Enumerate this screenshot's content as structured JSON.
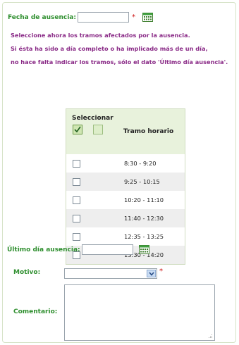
{
  "form": {
    "fecha_label": "Fecha de ausencia:",
    "fecha_value": "",
    "required_mark": "*",
    "info": [
      "Seleccione ahora los tramos afectados por la ausencia.",
      "Si ésta ha sido a día completo o ha implicado más de un día,",
      "no hace falta indicar los tramos, sólo el dato 'Último día ausencia'."
    ],
    "table": {
      "col_select": "Seleccionar",
      "col_tramo": "Tramo horario",
      "rows": [
        {
          "tramo": "8:30 - 9:20",
          "checked": false
        },
        {
          "tramo": "9:25 - 10:15",
          "checked": false
        },
        {
          "tramo": "10:20 - 11:10",
          "checked": false
        },
        {
          "tramo": "11:40 - 12:30",
          "checked": false
        },
        {
          "tramo": "12:35 - 13:25",
          "checked": false
        },
        {
          "tramo": "13:30 - 14:20",
          "checked": false
        }
      ]
    },
    "ultimo_label": "Último día ausencia:",
    "ultimo_value": "",
    "motivo_label": "Motivo:",
    "motivo_value": "",
    "comentario_label": "Comentario:",
    "comentario_value": ""
  },
  "colors": {
    "label_green": "#2f8f2f",
    "info_purple": "#8a2b87",
    "required_red": "#cc1111",
    "table_header_bg": "#e8f2dc"
  }
}
